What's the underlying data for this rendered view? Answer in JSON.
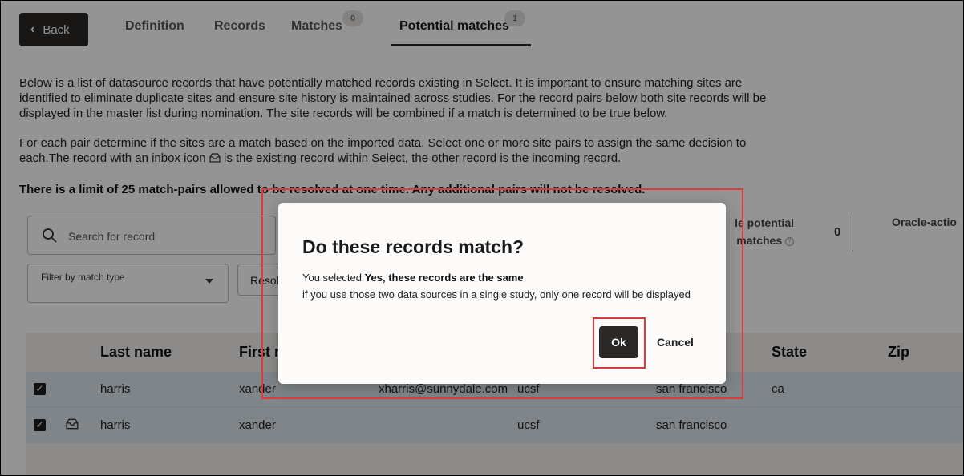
{
  "header": {
    "back_label": "Back",
    "tabs": [
      {
        "label": "Definition"
      },
      {
        "label": "Records"
      },
      {
        "label": "Matches",
        "count": "0"
      },
      {
        "label": "Potential matches",
        "count": "1"
      }
    ]
  },
  "intro": {
    "p1": "Below is a list of datasource records that have potentially matched records existing in Select. It is important to ensure matching sites are identified to eliminate duplicate sites and ensure site history is maintained across studies. For the record pairs below both site records will be displayed in the master list during nomination. The site records will be combined if a match is determined to be true below.",
    "p2a": "For each pair determine if the sites are a match based on the imported data. Select one or more site pairs to assign the same decision to each.The record with an inbox icon",
    "p2b": "is the existing record within Select, the other record is the incoming record.",
    "p3": "There is a limit of 25 match-pairs allowed to be resolved at one time. Any additional pairs will not be resolved."
  },
  "toolbar": {
    "search_placeholder": "Search for record",
    "filter_label": "Filter by match type",
    "resolve_label": "Resolve",
    "stat1_line1": "le potential",
    "stat1_line2": "matches",
    "stat1_value": "0",
    "stat2_label": "Oracle-actio"
  },
  "table": {
    "columns": [
      "Last name",
      "First n",
      "State",
      "Zip"
    ],
    "rows": [
      {
        "last": "harris",
        "first": "xander",
        "email": "xharris@sunnydale.com",
        "org": "ucsf",
        "city": "san francisco",
        "state": "ca",
        "checked": true,
        "inbox": false
      },
      {
        "last": "harris",
        "first": "xander",
        "email": "",
        "org": "ucsf",
        "city": "san francisco",
        "state": "",
        "checked": true,
        "inbox": true
      }
    ]
  },
  "dialog": {
    "title": "Do these records match?",
    "line1_prefix": "You selected ",
    "line1_bold": "Yes, these records are the same",
    "line2": "if you use those two data sources in a single study, only one record will be displayed",
    "ok_label": "Ok",
    "cancel_label": "Cancel"
  },
  "colors": {
    "dark_button": "#2b2927",
    "highlight": "#e0393b",
    "row_selected": "#dbe5ec"
  }
}
